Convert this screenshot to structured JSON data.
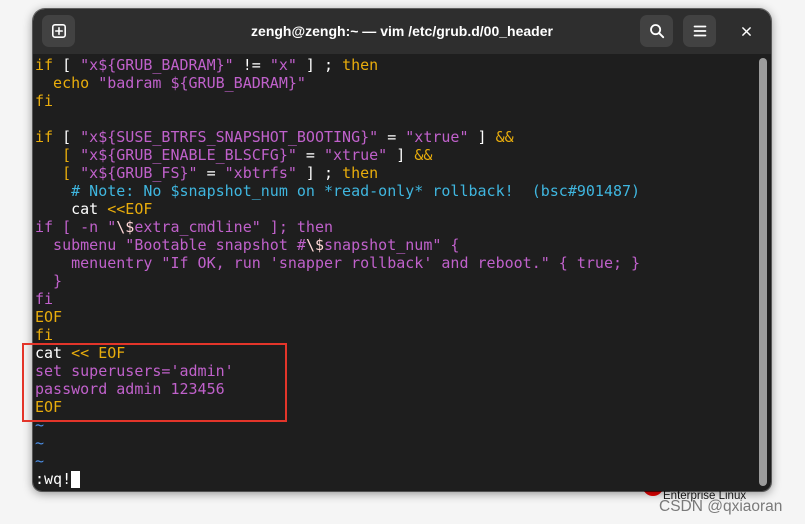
{
  "window": {
    "title": "zengh@zengh:~ — vim /etc/grub.d/00_header",
    "icons": {
      "new_tab": "new-tab-icon",
      "search": "search-icon",
      "menu": "menu-icon",
      "close": "close-icon"
    },
    "colors": {
      "titlebar_background": "#2e2e2e",
      "button_background": "#424242",
      "title_text": "#ffffff"
    }
  },
  "terminal": {
    "colors": {
      "background": "#1e1e1e",
      "default_text": "#ffffff",
      "cursor": "#ffffff",
      "scrollbar": "#9b9b9b"
    },
    "lines": [
      [
        {
          "t": "if",
          "fg": "#e9ad0c"
        },
        {
          "t": " [ "
        },
        {
          "t": "\"x${GRUB_BADRAM}\"",
          "fg": "#c061cb"
        },
        {
          "t": " != "
        },
        {
          "t": "\"x\"",
          "fg": "#c061cb"
        },
        {
          "t": " ] ; "
        },
        {
          "t": "then",
          "fg": "#e9ad0c"
        }
      ],
      [
        {
          "t": "  echo",
          "fg": "#e9ad0c"
        },
        {
          "t": " \"badram ${GRUB_BADRAM}\"",
          "fg": "#c061cb"
        }
      ],
      [
        {
          "t": "fi",
          "fg": "#e9ad0c"
        }
      ],
      [],
      [
        {
          "t": "if",
          "fg": "#e9ad0c"
        },
        {
          "t": " [ "
        },
        {
          "t": "\"x${SUSE_BTRFS_SNAPSHOT_BOOTING}\"",
          "fg": "#c061cb"
        },
        {
          "t": " = "
        },
        {
          "t": "\"xtrue\"",
          "fg": "#c061cb"
        },
        {
          "t": " ] "
        },
        {
          "t": "&&",
          "fg": "#e9ad0c"
        }
      ],
      [
        {
          "t": "   [",
          "fg": "#e9ad0c"
        },
        {
          "t": " \"x${GRUB_ENABLE_BLSCFG}\"",
          "fg": "#c061cb"
        },
        {
          "t": " = "
        },
        {
          "t": "\"xtrue\"",
          "fg": "#c061cb"
        },
        {
          "t": " ] "
        },
        {
          "t": "&&",
          "fg": "#e9ad0c"
        }
      ],
      [
        {
          "t": "   [",
          "fg": "#e9ad0c"
        },
        {
          "t": " \"x${GRUB_FS}\"",
          "fg": "#c061cb"
        },
        {
          "t": " = "
        },
        {
          "t": "\"xbtrfs\"",
          "fg": "#c061cb"
        },
        {
          "t": " ] ; "
        },
        {
          "t": "then",
          "fg": "#e9ad0c"
        }
      ],
      [
        {
          "t": "    # Note: No $snapshot_num on *read-only* rollback!  (bsc#901487)",
          "fg": "#3fb6df"
        }
      ],
      [
        {
          "t": "    cat "
        },
        {
          "t": "<<EOF",
          "fg": "#e9ad0c"
        }
      ],
      [
        {
          "t": "if [ -n \"",
          "fg": "#c061cb"
        },
        {
          "t": "\\$",
          "fg": "#ffd7d7"
        },
        {
          "t": "extra_cmdline\" ]; then",
          "fg": "#c061cb"
        }
      ],
      [
        {
          "t": "  submenu \"Bootable snapshot #",
          "fg": "#c061cb"
        },
        {
          "t": "\\$",
          "fg": "#ffd7d7"
        },
        {
          "t": "snapshot_num\" {",
          "fg": "#c061cb"
        }
      ],
      [
        {
          "t": "    menuentry \"If OK, run 'snapper rollback' and reboot.\" { true; }",
          "fg": "#c061cb"
        }
      ],
      [
        {
          "t": "  }",
          "fg": "#c061cb"
        }
      ],
      [
        {
          "t": "fi",
          "fg": "#c061cb"
        }
      ],
      [
        {
          "t": "EOF",
          "fg": "#e9ad0c"
        }
      ],
      [
        {
          "t": "fi",
          "fg": "#e9ad0c"
        }
      ],
      [
        {
          "t": "cat "
        },
        {
          "t": "<< EOF",
          "fg": "#e9ad0c"
        }
      ],
      [
        {
          "t": "set superusers='admin'",
          "fg": "#c061cb"
        }
      ],
      [
        {
          "t": "password admin 123456",
          "fg": "#c061cb"
        }
      ],
      [
        {
          "t": "EOF",
          "fg": "#e9ad0c"
        }
      ],
      [
        {
          "t": "~",
          "fg": "#4c8fe6"
        }
      ],
      [
        {
          "t": "~",
          "fg": "#4c8fe6"
        }
      ],
      [
        {
          "t": "~",
          "fg": "#4c8fe6"
        }
      ]
    ],
    "command_line": ":wq!"
  },
  "annotation": {
    "border_color": "#e3352a"
  },
  "desktop": {
    "background": "#f5f5f5",
    "brand_logo_color": "#ee0000",
    "brand_text": "Enterprise Linux",
    "watermark": "CSDN @qxiaoran",
    "watermark_color": "#7a7a7a"
  }
}
